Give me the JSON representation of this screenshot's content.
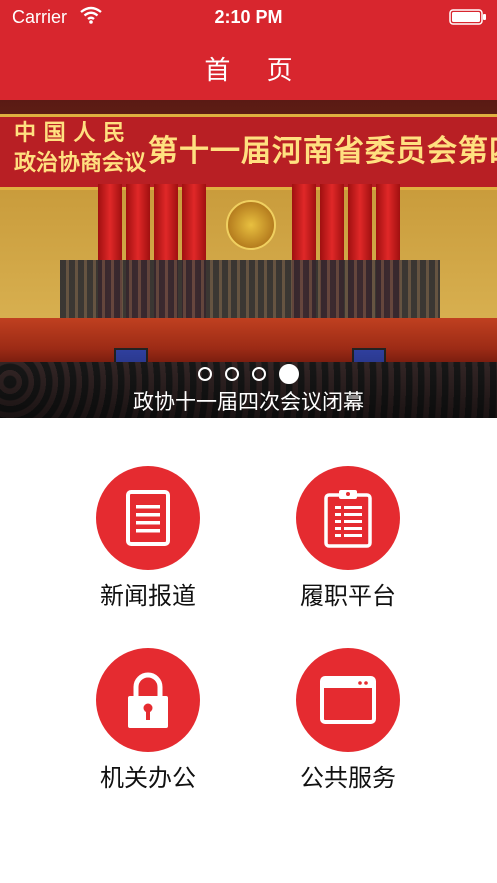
{
  "status_bar": {
    "carrier": "Carrier",
    "time": "2:10 PM"
  },
  "nav": {
    "title": "首 页"
  },
  "banner": {
    "caption": "政协十一届四次会议闭幕",
    "banner_text_left": "中 国 人 民\n政治协商会议",
    "banner_text_right": "第十一届河南省委员会第四次会议",
    "page_count": 4,
    "active_index": 3
  },
  "grid": [
    {
      "label": "新闻报道",
      "icon": "document-list-icon"
    },
    {
      "label": "履职平台",
      "icon": "clipboard-icon"
    },
    {
      "label": "机关办公",
      "icon": "lock-icon"
    },
    {
      "label": "公共服务",
      "icon": "browser-window-icon"
    }
  ],
  "colors": {
    "brand_red": "#d8262e",
    "circle_red": "#e52b30"
  }
}
